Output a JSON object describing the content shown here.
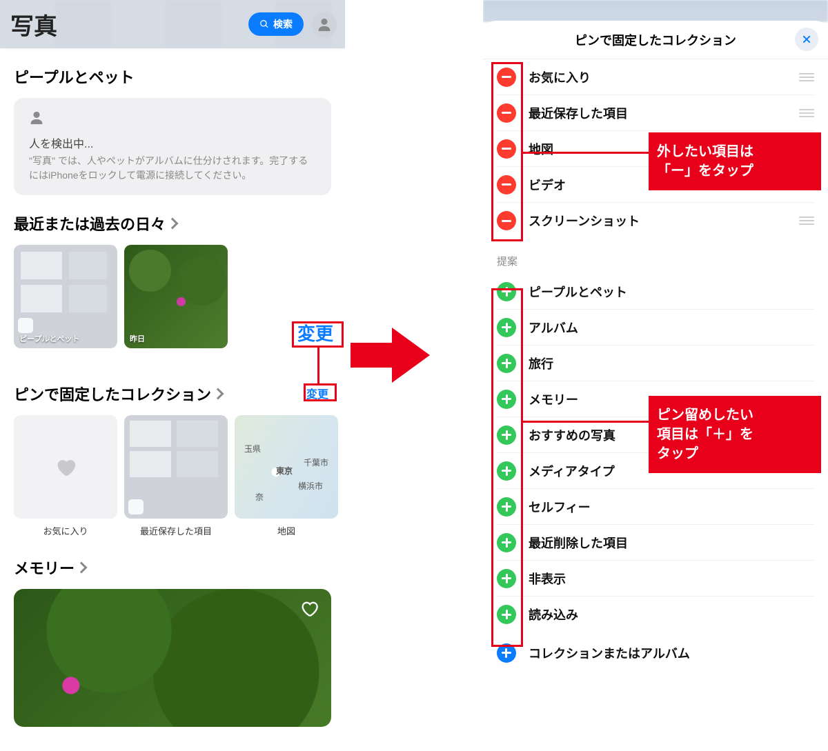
{
  "left": {
    "title": "写真",
    "search_label": "検索",
    "section_people": "ピープルとペット",
    "detect_card_title": "人を検出中...",
    "detect_card_body": "\"写真\" では、人やペットがアルバムに仕分けされます。完了するにはiPhoneをロックして電源に接続してください。",
    "section_days": "最近または過去の日々",
    "thumb1_caption": "ピープルとペット",
    "thumb2_caption": "昨日",
    "change_label": "変更",
    "section_pinned": "ピンで固定したコレクション",
    "pinned": [
      "お気に入り",
      "最近保存した項目",
      "地図"
    ],
    "map_labels": [
      "玉県",
      "東京",
      "千葉市",
      "横浜市",
      "奈"
    ],
    "section_memory": "メモリー"
  },
  "right": {
    "sheet_title": "ピンで固定したコレクション",
    "minus_items": [
      "お気に入り",
      "最近保存した項目",
      "地図",
      "ビデオ",
      "スクリーンショット"
    ],
    "suggestions_head": "提案",
    "plus_items": [
      "ピープルとペット",
      "アルバム",
      "旅行",
      "メモリー",
      "おすすめの写真",
      "メディアタイプ",
      "セルフィー",
      "最近削除した項目",
      "非表示",
      "読み込み"
    ],
    "add_collection": "コレクションまたはアルバム"
  },
  "notes": {
    "remove": "外したい項目は\n「ー」をタップ",
    "add": "ピン留めしたい\n項目は「＋」を\nタップ"
  }
}
